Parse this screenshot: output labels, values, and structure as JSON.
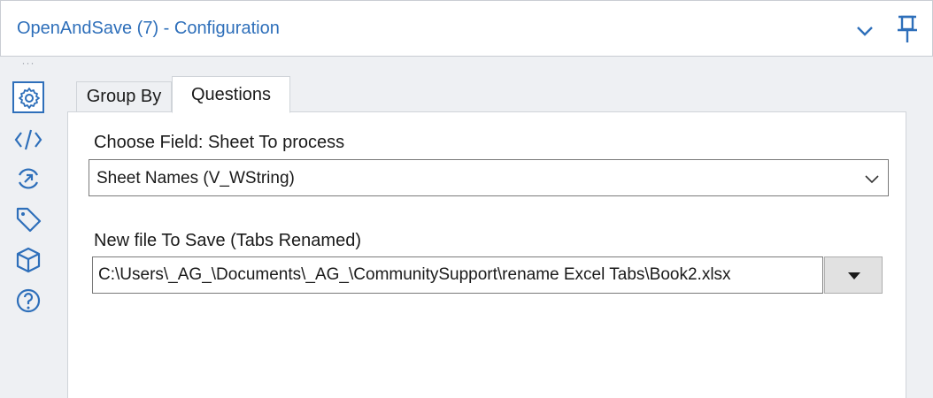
{
  "window": {
    "title": "OpenAndSave (7) - Configuration",
    "collapse_icon": "chevron-down-icon",
    "pin_icon": "pin-icon"
  },
  "rail": {
    "more": "···",
    "items": [
      {
        "name": "settings",
        "icon": "gear-icon",
        "active": true
      },
      {
        "name": "xml",
        "icon": "code-icon",
        "active": false
      },
      {
        "name": "connections",
        "icon": "connection-progress-icon",
        "active": false
      },
      {
        "name": "annotation",
        "icon": "tag-icon",
        "active": false
      },
      {
        "name": "metadata",
        "icon": "cube-icon",
        "active": false
      },
      {
        "name": "help",
        "icon": "help-icon",
        "active": false
      }
    ]
  },
  "tabs": [
    {
      "label": "Group By",
      "active": false
    },
    {
      "label": "Questions",
      "active": true
    }
  ],
  "questions": {
    "field_label": "Choose Field: Sheet To process",
    "field_value": "Sheet Names (V_WString)",
    "file_label": "New file To Save (Tabs Renamed)",
    "file_value": "C:\\Users\\_AG_\\Documents\\_AG_\\CommunitySupport\\rename Excel Tabs\\Book2.xlsx"
  },
  "colors": {
    "accent": "#2e6fba",
    "panel_bg": "#ffffff",
    "app_bg": "#eef0f3"
  }
}
